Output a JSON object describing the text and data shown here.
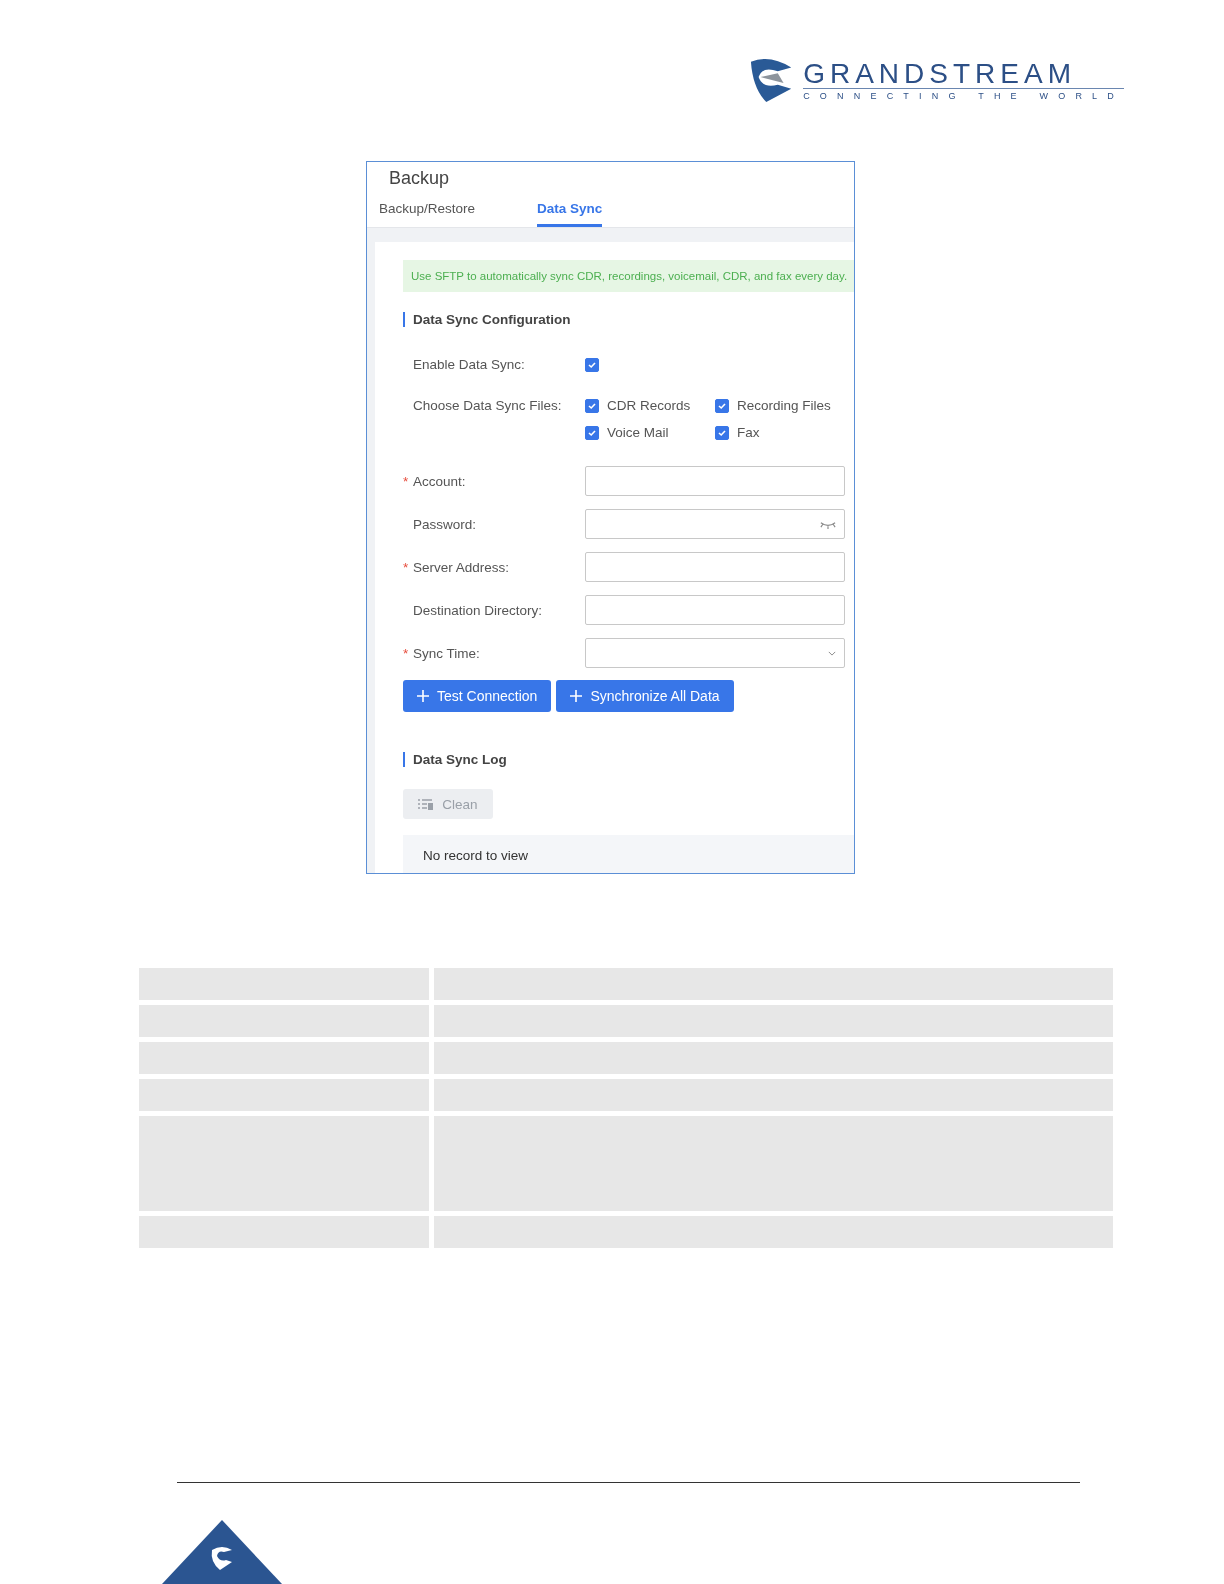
{
  "logo": {
    "name": "GRANDSTREAM",
    "tagline": "CONNECTING THE WORLD"
  },
  "window": {
    "title": "Backup"
  },
  "tabs": [
    {
      "label": "Backup/Restore",
      "selected": false
    },
    {
      "label": "Data Sync",
      "selected": true
    }
  ],
  "notice": "Use SFTP to automatically sync CDR, recordings, voicemail, CDR, and fax every day.",
  "config": {
    "heading": "Data Sync Configuration",
    "enable": {
      "label": "Enable Data Sync:",
      "checked": true
    },
    "files": {
      "label": "Choose Data Sync Files:",
      "options": [
        {
          "label": "CDR Records",
          "checked": true
        },
        {
          "label": "Recording Files",
          "checked": true
        },
        {
          "label": "Voice Mail",
          "checked": true
        },
        {
          "label": "Fax",
          "checked": true
        }
      ]
    },
    "fields": [
      {
        "label": "Account:",
        "required_mark": "*",
        "kind": "text"
      },
      {
        "label": "Password:",
        "kind": "password"
      },
      {
        "label": "Server Address:",
        "required_mark": "*",
        "kind": "text"
      },
      {
        "label": "Destination Directory:",
        "kind": "text"
      },
      {
        "label": "Sync Time:",
        "required_mark": "*",
        "kind": "select"
      }
    ],
    "buttons": [
      "Test Connection",
      "Synchronize All Data"
    ]
  },
  "log": {
    "heading": "Data Sync Log",
    "clean_button": {
      "label": "Clean",
      "disabled": true
    },
    "empty_text": "No record to view"
  },
  "table_rows": [
    {
      "kind": "short"
    },
    {
      "kind": "short"
    },
    {
      "kind": "short"
    },
    {
      "kind": "short"
    },
    {
      "kind": "tall"
    },
    {
      "kind": "short"
    }
  ]
}
